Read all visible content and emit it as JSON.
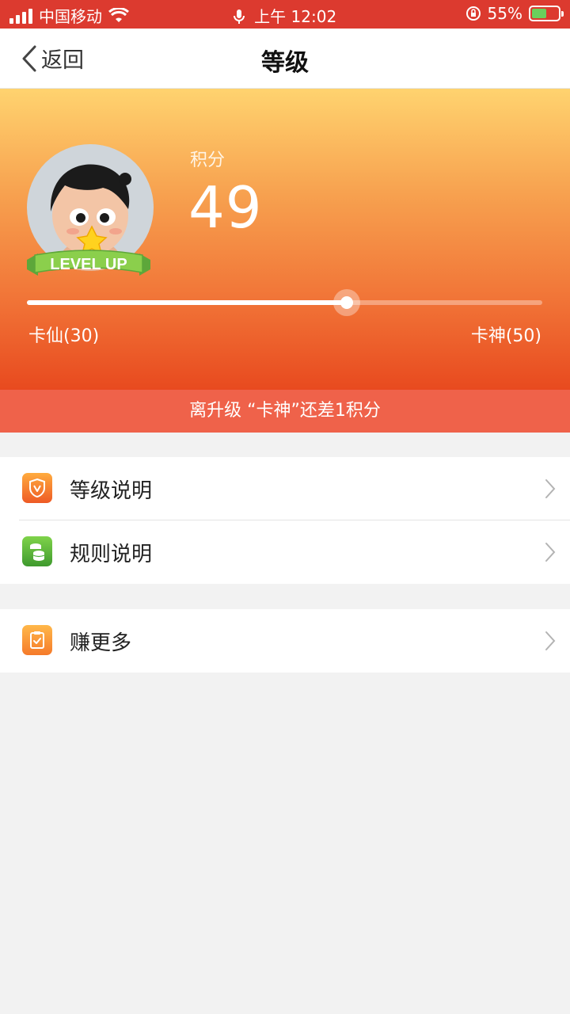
{
  "status_bar": {
    "carrier": "中国移动",
    "time": "上午 12:02",
    "battery": "55%"
  },
  "nav": {
    "back_label": "返回",
    "title": "等级"
  },
  "hero": {
    "points_label": "积分",
    "points_value": "49",
    "badge_text": "LEVEL UP",
    "level_current": "卡仙(30)",
    "level_next": "卡神(50)",
    "progress_fraction": 0.62,
    "hint": "离升级 “卡神”还差1积分"
  },
  "menu": {
    "level_desc": "等级说明",
    "rules_desc": "规则说明",
    "earn_more": "赚更多"
  },
  "icons": {
    "level_desc_icon": "shield-v-icon",
    "rules_desc_icon": "coins-icon",
    "earn_more_icon": "clipboard-check-icon"
  },
  "colors": {
    "status_bar": "#dc3a2f",
    "hint_bar": "#ef624a",
    "orange_icon": "#f0702e",
    "green_icon": "#4caf3a"
  }
}
